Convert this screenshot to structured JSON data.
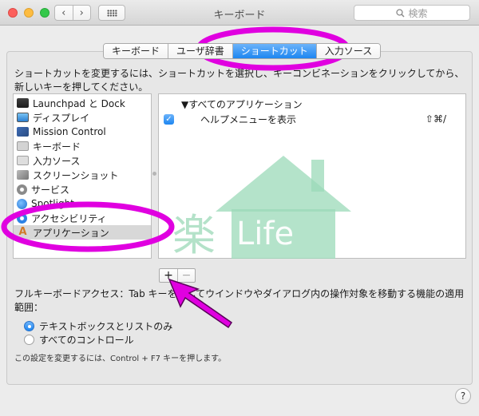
{
  "window": {
    "title": "キーボード"
  },
  "toolbar": {
    "back": "‹",
    "forward": "›",
    "search_placeholder": "検索"
  },
  "tabs": [
    {
      "label": "キーボード",
      "active": false
    },
    {
      "label": "ユーザ辞書",
      "active": false
    },
    {
      "label": "ショートカット",
      "active": true
    },
    {
      "label": "入力ソース",
      "active": false
    }
  ],
  "instructions": "ショートカットを変更するには、ショートカットを選択し、キーコンビネーションをクリックしてから、新しいキーを押してください。",
  "categories": [
    {
      "label": "Launchpad と Dock",
      "icon": "launchpad-icon"
    },
    {
      "label": "ディスプレイ",
      "icon": "display-icon"
    },
    {
      "label": "Mission Control",
      "icon": "mission-control-icon"
    },
    {
      "label": "キーボード",
      "icon": "keyboard-icon"
    },
    {
      "label": "入力ソース",
      "icon": "input-source-icon"
    },
    {
      "label": "スクリーンショット",
      "icon": "screenshot-icon"
    },
    {
      "label": "サービス",
      "icon": "gear-icon"
    },
    {
      "label": "Spotlight",
      "icon": "spotlight-icon"
    },
    {
      "label": "アクセシビリティ",
      "icon": "accessibility-icon"
    },
    {
      "label": "アプリケーション",
      "icon": "app-icon",
      "selected": true
    }
  ],
  "shortcuts": {
    "group": "▼すべてのアプリケーション",
    "items": [
      {
        "checked": true,
        "label": "ヘルプメニューを表示",
        "keys": "⇧⌘/"
      }
    ]
  },
  "buttons": {
    "add": "+",
    "remove": "−",
    "help": "?"
  },
  "full_keyboard_access": {
    "description": "フルキーボードアクセス：Tab キーを押してウインドウやダイアログ内の操作対象を移動する機能の適用範囲：",
    "options": [
      {
        "label": "テキストボックスとリストのみ",
        "selected": true
      },
      {
        "label": "すべてのコントロール",
        "selected": false
      }
    ],
    "note": "この設定を変更するには、Control + F7 キーを押します。"
  },
  "watermark": {
    "kanji": "楽",
    "text": "Life"
  },
  "colors": {
    "accent": "#1d86f1",
    "annotation": "#e000e0",
    "watermark": "#9bd9b8"
  }
}
